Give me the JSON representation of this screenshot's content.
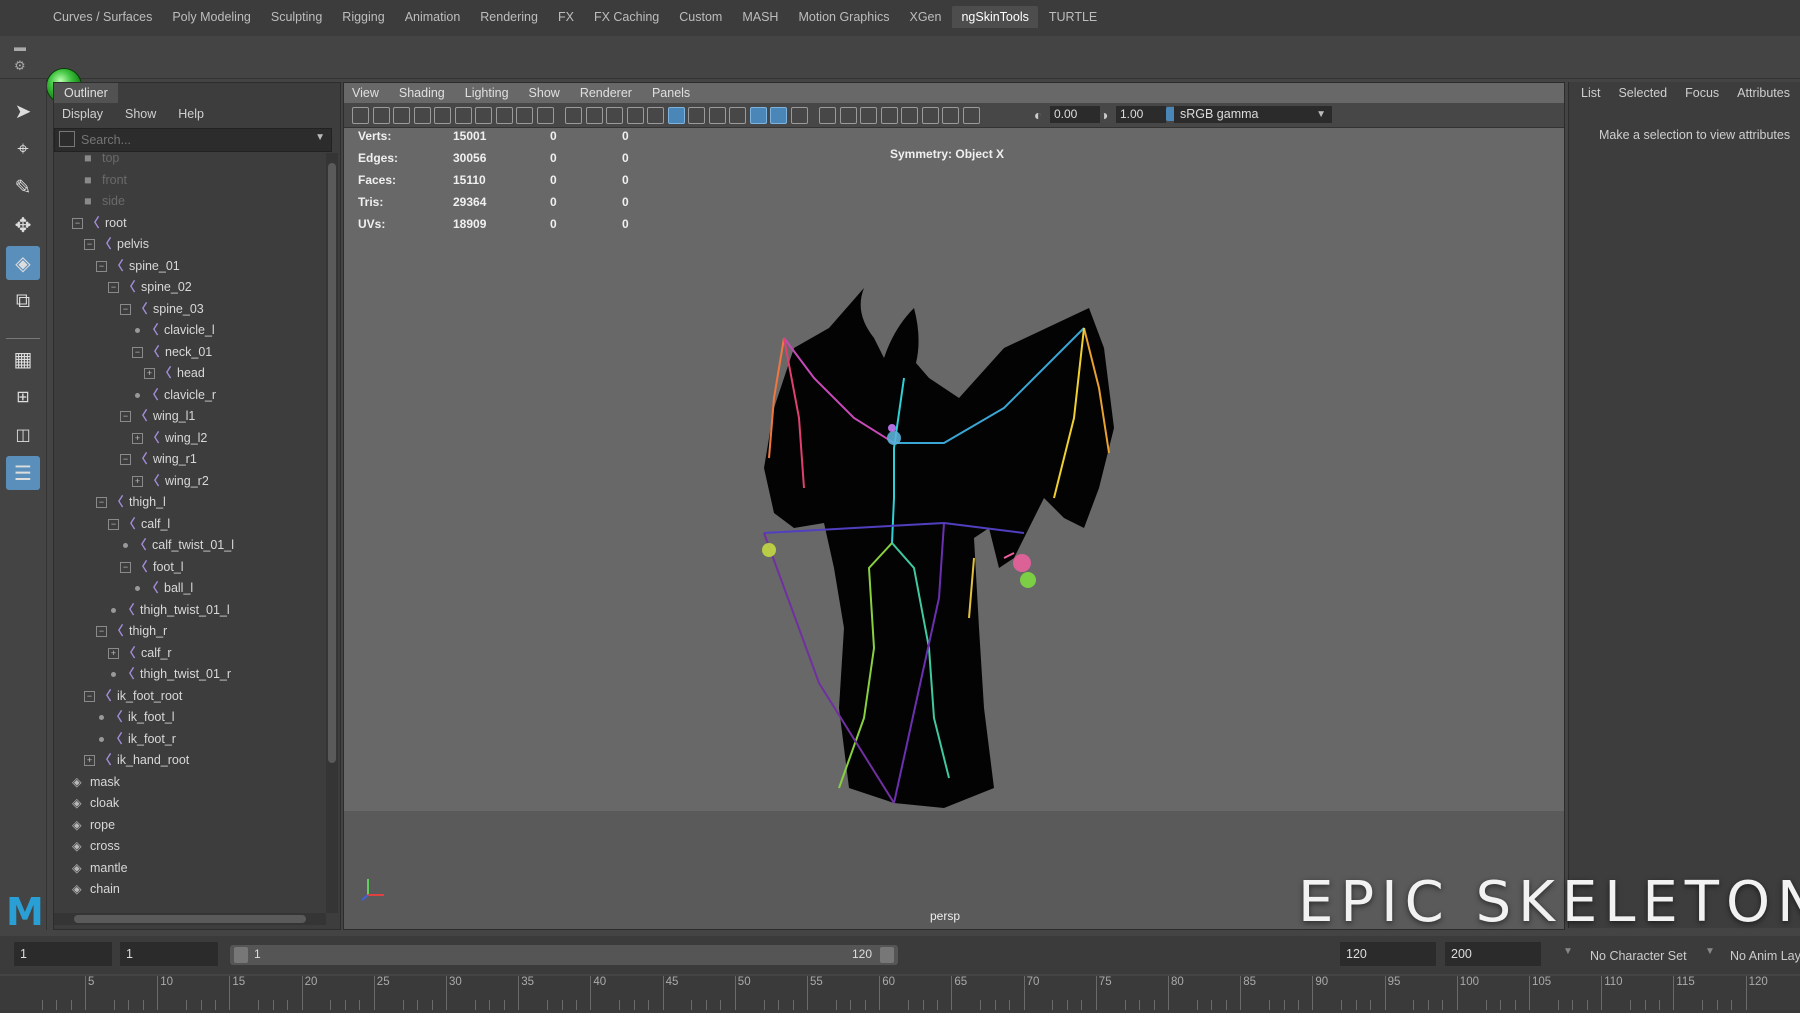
{
  "shelf": {
    "tabs": [
      "Curves / Surfaces",
      "Poly Modeling",
      "Sculpting",
      "Rigging",
      "Animation",
      "Rendering",
      "FX",
      "FX Caching",
      "Custom",
      "MASH",
      "Motion Graphics",
      "XGen",
      "ngSkinTools",
      "TURTLE"
    ],
    "active_tab": "ngSkinTools"
  },
  "outliner": {
    "tab_title": "Outliner",
    "menu": [
      "Display",
      "Show",
      "Help"
    ],
    "search_placeholder": "Search...",
    "items": [
      {
        "label": "top",
        "type": "camera",
        "dim": true
      },
      {
        "label": "front",
        "type": "camera",
        "dim": true
      },
      {
        "label": "side",
        "type": "camera",
        "dim": true
      },
      {
        "label": "root",
        "type": "joint",
        "expander": "−"
      },
      {
        "label": "pelvis",
        "type": "joint",
        "expander": "−"
      },
      {
        "label": "spine_01",
        "type": "joint",
        "expander": "−"
      },
      {
        "label": "spine_02",
        "type": "joint",
        "expander": "−"
      },
      {
        "label": "spine_03",
        "type": "joint",
        "expander": "−"
      },
      {
        "label": "clavicle_l",
        "type": "joint"
      },
      {
        "label": "neck_01",
        "type": "joint",
        "expander": "−"
      },
      {
        "label": "head",
        "type": "joint",
        "expander": "+"
      },
      {
        "label": "clavicle_r",
        "type": "joint"
      },
      {
        "label": "wing_l1",
        "type": "joint",
        "expander": "−"
      },
      {
        "label": "wing_l2",
        "type": "joint",
        "expander": "+"
      },
      {
        "label": "wing_r1",
        "type": "joint",
        "expander": "−"
      },
      {
        "label": "wing_r2",
        "type": "joint",
        "expander": "+"
      },
      {
        "label": "thigh_l",
        "type": "joint",
        "expander": "−"
      },
      {
        "label": "calf_l",
        "type": "joint",
        "expander": "−"
      },
      {
        "label": "calf_twist_01_l",
        "type": "joint"
      },
      {
        "label": "foot_l",
        "type": "joint",
        "expander": "−"
      },
      {
        "label": "ball_l",
        "type": "joint"
      },
      {
        "label": "thigh_twist_01_l",
        "type": "joint"
      },
      {
        "label": "thigh_r",
        "type": "joint",
        "expander": "−"
      },
      {
        "label": "calf_r",
        "type": "joint",
        "expander": "+"
      },
      {
        "label": "thigh_twist_01_r",
        "type": "joint"
      },
      {
        "label": "ik_foot_root",
        "type": "joint",
        "expander": "−"
      },
      {
        "label": "ik_foot_l",
        "type": "joint"
      },
      {
        "label": "ik_foot_r",
        "type": "joint"
      },
      {
        "label": "ik_hand_root",
        "type": "joint",
        "expander": "+"
      },
      {
        "label": "mask",
        "type": "mesh"
      },
      {
        "label": "cloak",
        "type": "mesh"
      },
      {
        "label": "rope",
        "type": "mesh"
      },
      {
        "label": "cross",
        "type": "mesh"
      },
      {
        "label": "mantle",
        "type": "mesh"
      },
      {
        "label": "chain",
        "type": "mesh"
      }
    ]
  },
  "viewport": {
    "menu": [
      "View",
      "Shading",
      "Lighting",
      "Show",
      "Renderer",
      "Panels"
    ],
    "exposure": "0.00",
    "gamma": "1.00",
    "color_space": "sRGB gamma",
    "hud": [
      {
        "label": "Verts:",
        "v1": "15001",
        "v2": "0",
        "v3": "0"
      },
      {
        "label": "Edges:",
        "v1": "30056",
        "v2": "0",
        "v3": "0"
      },
      {
        "label": "Faces:",
        "v1": "15110",
        "v2": "0",
        "v3": "0"
      },
      {
        "label": "Tris:",
        "v1": "29364",
        "v2": "0",
        "v3": "0"
      },
      {
        "label": "UVs:",
        "v1": "18909",
        "v2": "0",
        "v3": "0"
      }
    ],
    "symmetry": "Symmetry: Object X",
    "camera": "persp"
  },
  "channel_box": {
    "tabs": [
      "List",
      "Selected",
      "Focus",
      "Attributes"
    ],
    "message": "Make a selection to view attributes"
  },
  "range": {
    "start": "1",
    "playback_start": "1",
    "slider_start": "1",
    "slider_end": "120",
    "playback_end": "120",
    "end": "200",
    "character_set": "No Character Set",
    "anim_layer": "No Anim Lay"
  },
  "timeline": {
    "ticks": [
      "5",
      "10",
      "15",
      "20",
      "25",
      "30",
      "35",
      "40",
      "45",
      "50",
      "55",
      "60",
      "65",
      "70",
      "75",
      "80",
      "85",
      "90",
      "95",
      "100",
      "105",
      "110",
      "115",
      "120"
    ]
  },
  "watermark": "EPIC SKELETON",
  "colors": {
    "selection_blue": "#5a8fbc",
    "joint_purple": "#a38bd8"
  }
}
